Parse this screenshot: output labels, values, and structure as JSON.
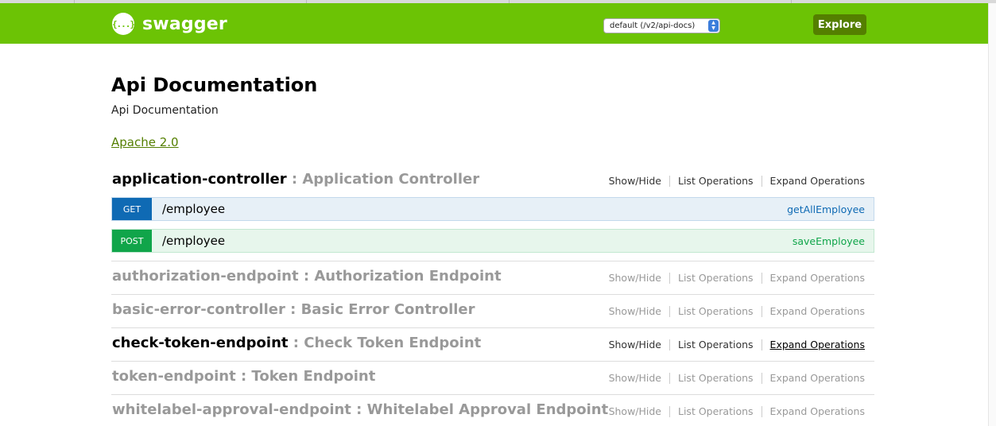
{
  "header": {
    "logo_icon": "{...}",
    "logo_text": "swagger",
    "api_select_value": "default (/v2/api-docs)",
    "explore_label": "Explore",
    "colors": {
      "header_bg": "#6cc305",
      "explore_bg": "#547f00"
    }
  },
  "info": {
    "title": "Api Documentation",
    "description": "Api Documentation",
    "license": "Apache 2.0"
  },
  "ops_labels": {
    "show_hide": "Show/Hide",
    "list_operations": "List Operations",
    "expand_operations": "Expand Operations"
  },
  "resources": [
    {
      "name": "application-controller",
      "desc": " : Application Controller",
      "operations": [
        {
          "method": "GET",
          "path": "/employee",
          "nickname": "getAllEmployee"
        },
        {
          "method": "POST",
          "path": "/employee",
          "nickname": "saveEmployee"
        }
      ]
    },
    {
      "name": "authorization-endpoint",
      "desc": " : Authorization Endpoint"
    },
    {
      "name": "basic-error-controller",
      "desc": " : Basic Error Controller"
    },
    {
      "name": "check-token-endpoint",
      "desc": " : Check Token Endpoint"
    },
    {
      "name": "token-endpoint",
      "desc": " : Token Endpoint"
    },
    {
      "name": "whitelabel-approval-endpoint",
      "desc": " : Whitelabel Approval Endpoint"
    }
  ]
}
